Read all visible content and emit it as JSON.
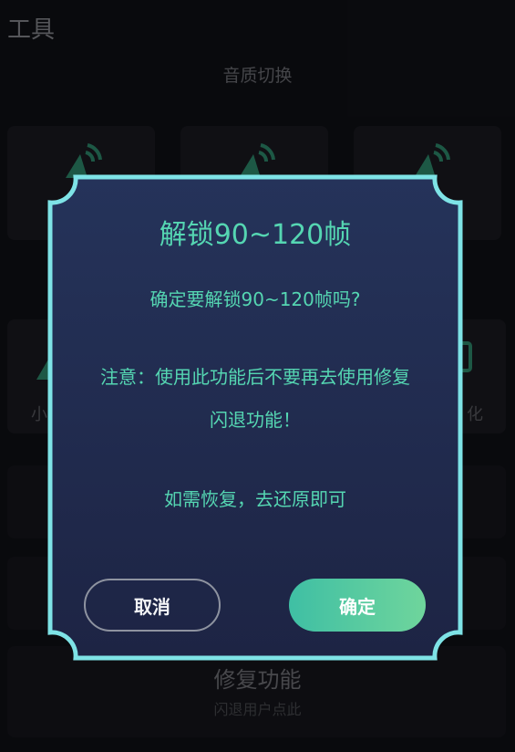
{
  "page": {
    "title": "工具",
    "section_title": "音质切换",
    "tile_left_label_fragment": "小",
    "tile_right_label_fragment": "化",
    "bottom_item": {
      "title": "修复功能",
      "subtitle": "闪退用户点此"
    }
  },
  "dialog": {
    "title": "解锁90~120帧",
    "question": "确定要解锁90~120帧吗?",
    "note_line1": "注意：使用此功能后不要再去使用修复",
    "note_line2": "闪退功能！",
    "restore_hint": "如需恢复，去还原即可",
    "cancel_label": "取消",
    "confirm_label": "确定"
  },
  "colors": {
    "accent": "#55d6b2",
    "frame": "#7ee3e6",
    "dialog_bg_top": "#25335a",
    "dialog_bg_bottom": "#1d2444",
    "confirm_gradient_start": "#3fbfa4",
    "confirm_gradient_end": "#6fd59c"
  },
  "icons": [
    "speaker-wave-icon",
    "speaker-wave-icon",
    "speaker-wave-icon",
    "tool-icon"
  ]
}
